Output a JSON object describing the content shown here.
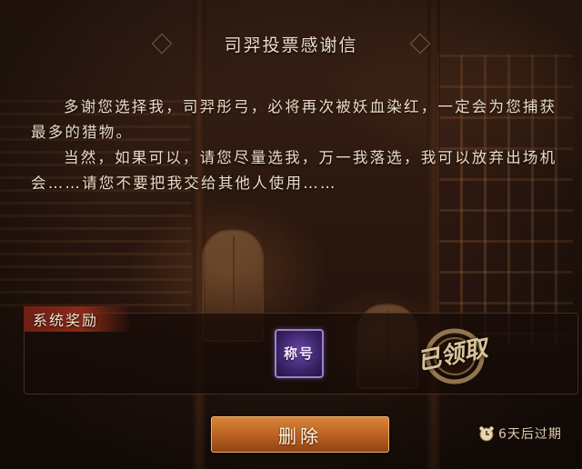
{
  "dialog": {
    "title": "司羿投票感谢信"
  },
  "letter": {
    "paragraphs": [
      "多谢您选择我，司羿彤弓，必将再次被妖血染红，一定会为您捕获最多的猎物。",
      "当然，如果可以，请您尽量选我，万一我落选，我可以放弃出场机会……请您不要把我交给其他人使用……"
    ]
  },
  "rewards": {
    "section_label": "系统奖励",
    "items": [
      {
        "label": "称号",
        "icon": "title-badge-icon",
        "color": "#6c48a8"
      }
    ],
    "stamp_text": "已领取"
  },
  "actions": {
    "delete_label": "删除"
  },
  "expiry": {
    "text": "6天后过期",
    "icon": "clock-icon"
  },
  "colors": {
    "accent": "#b9601f",
    "tag": "#8a2a18",
    "text": "#eadcc6"
  }
}
